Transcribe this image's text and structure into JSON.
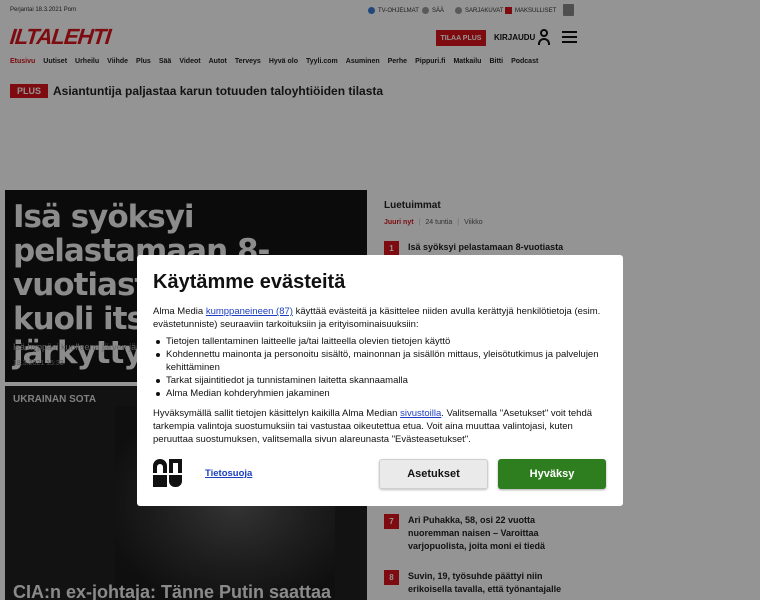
{
  "topbar": {
    "date": "Perjantai 18.3.2021  Porn",
    "links": [
      {
        "label": "TV-OHJELMAT",
        "color": "#3a7bd5"
      },
      {
        "label": "SÄÄ",
        "color": "#999999"
      },
      {
        "label": "SARJAKUVAT",
        "color": "#999999"
      },
      {
        "label": "MAKSULLISET",
        "color": "#d7141a"
      }
    ]
  },
  "header": {
    "logo": "ILTALEHTI",
    "subscribe_label": "TILAA PLUS",
    "login_label": "KIRJAUDU"
  },
  "nav": {
    "items": [
      "Etusivu",
      "Uutiset",
      "Urheilu",
      "Viihde",
      "Plus",
      "Sää",
      "Videot",
      "Autot",
      "Terveys",
      "Hyvä olo",
      "Tyyli.com",
      "Asuminen",
      "Perhe",
      "Pippuri.fi",
      "Matkailu",
      "Bitti",
      "Podcast"
    ]
  },
  "plus_headline": {
    "badge": "PLUS",
    "text": "Asiantuntija paljastaa karun totuuden taloyhtiöiden tilasta"
  },
  "main_article": {
    "title": "Isä syöksyi pelastamaan 8-vuotiasta vedestä, kuoli itse – Poliisi: järkyttynyt",
    "subtitle": "Isä hyppäsi kuolleena järven jäihin",
    "meta": "18.3.2021 15:33"
  },
  "second_article": {
    "label": "UKRAINAN SOTA",
    "title": "CIA:n ex-johtaja: Tänne Putin saattaa"
  },
  "most_read": {
    "title": "Luetuimmat",
    "tabs": [
      "Juuri nyt",
      "24 tuntia",
      "Viikko"
    ],
    "items": [
      {
        "num": "1",
        "text": "Isä syöksyi pelastamaan 8-vuotiasta"
      },
      {
        "num": "7",
        "text": "Ari Puhakka, 58, osi 22 vuotta nuoremman naisen – Varoittaa varjopuolista, joita moni ei tiedä"
      },
      {
        "num": "8",
        "text": "Suvin, 19, työsuhde päättyi niin erikoisella tavalla, että työnantajalle"
      }
    ]
  },
  "consent": {
    "heading": "Käytämme evästeitä",
    "intro_before": "Alma Media ",
    "intro_link": "kumppaneineen (87)",
    "intro_after": " käyttää evästeitä ja käsittelee niiden avulla kerättyjä henkilötietoja (esim. evästetunniste) seuraaviin tarkoituksiin ja erityisominaisuuksiin:",
    "purposes": [
      "Tietojen tallentaminen laitteelle ja/tai laitteella olevien tietojen käyttö",
      "Kohdennettu mainonta ja personoitu sisältö, mainonnan ja sisällön mittaus, yleisötutkimus ja palvelujen kehittäminen",
      "Tarkat sijaintitiedot ja tunnistaminen laitetta skannaamalla",
      "Alma Median kohderyhmien jakaminen"
    ],
    "para_before": "Hyväksymällä sallit tietojen käsittelyn kaikilla Alma Median ",
    "para_link": "sivustoilla",
    "para_after": ". Valitsemalla \"Asetukset\" voit tehdä tarkempia valintoja suostumuksiin tai vastustaa oikeutettua etua. Voit aina muuttaa valintojasi, kuten peruuttaa suostumuksen, valitsemalla sivun alareunasta \"Evästeasetukset\".",
    "privacy_link": "Tietosuoja",
    "settings_button": "Asetukset",
    "accept_button": "Hyväksy",
    "colors": {
      "accept": "#2e7d1f",
      "link": "#1d3fbf"
    }
  }
}
